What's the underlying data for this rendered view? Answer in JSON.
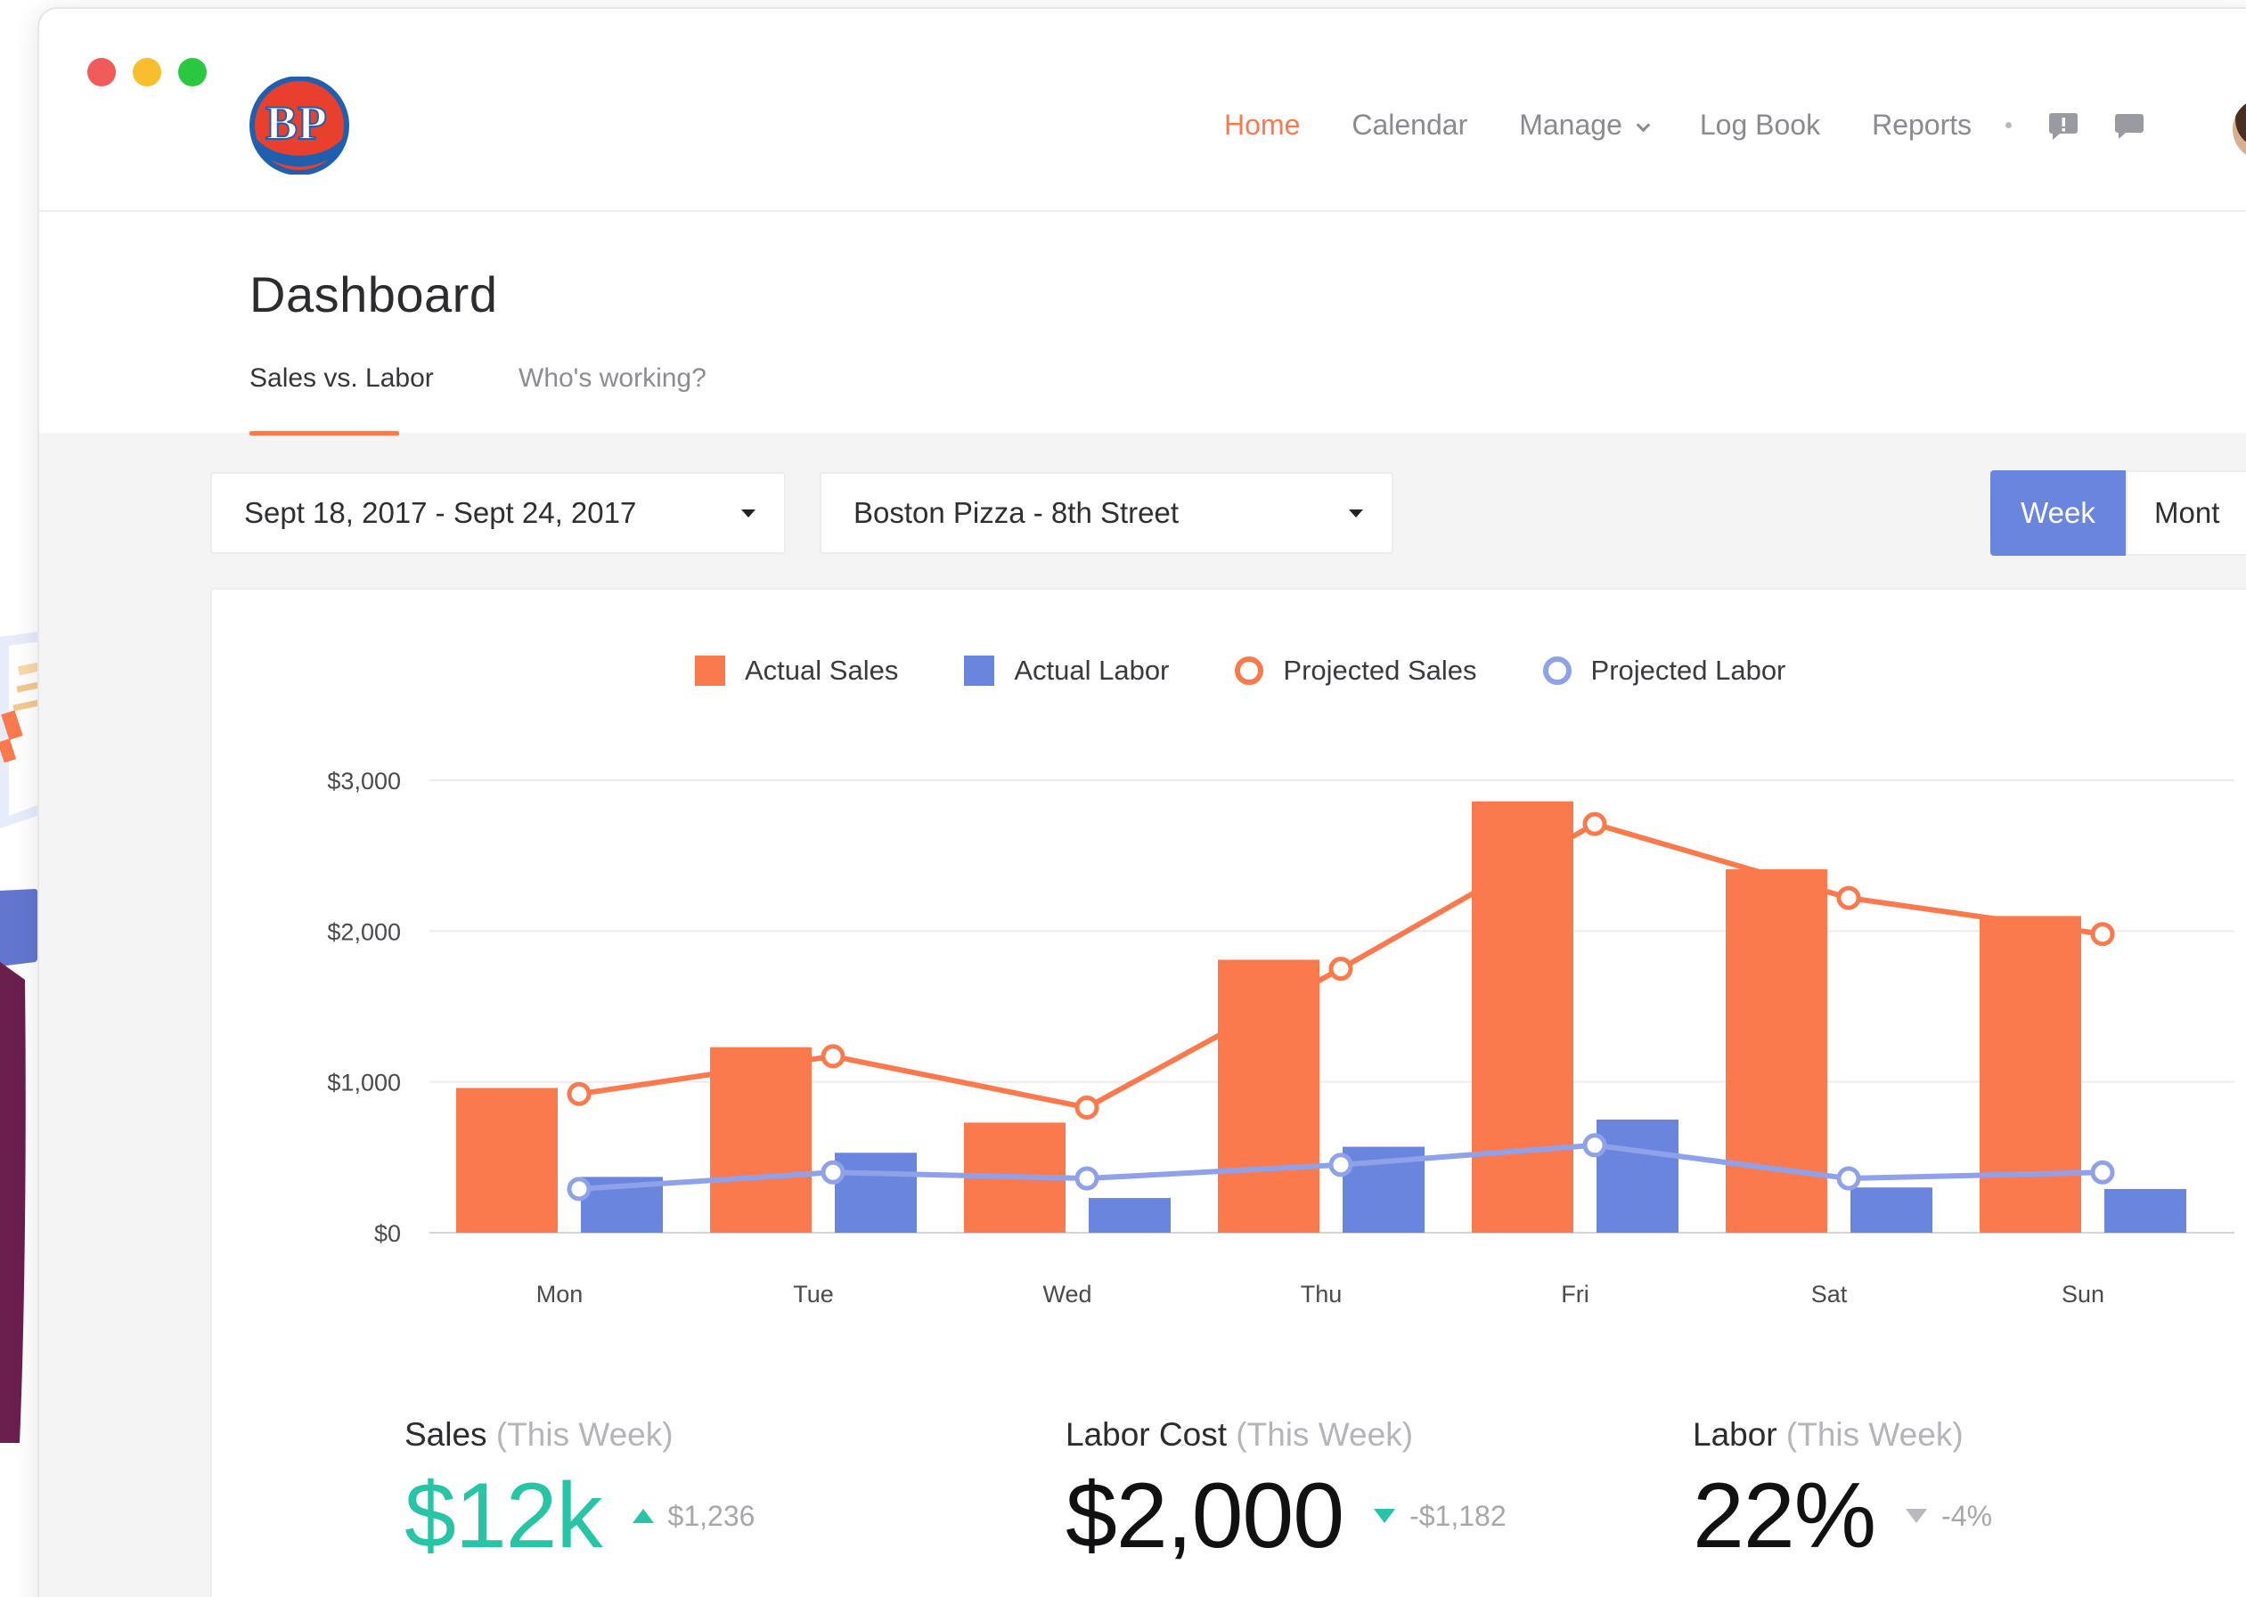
{
  "window": {
    "traffic_lights": [
      "#f15b59",
      "#f9be2e",
      "#2ac840"
    ]
  },
  "brand": {
    "logo_text": "BP",
    "logo_colors": [
      "#e8402d",
      "#1f5fb0",
      "#ffffff"
    ]
  },
  "nav": {
    "items": [
      {
        "label": "Home",
        "active": true
      },
      {
        "label": "Calendar",
        "active": false
      },
      {
        "label": "Manage",
        "active": false,
        "has_dropdown": true
      },
      {
        "label": "Log Book",
        "active": false
      },
      {
        "label": "Reports",
        "active": false
      }
    ],
    "icons": [
      "alert-icon",
      "chat-icon"
    ],
    "accent": "#fb7a4d"
  },
  "page": {
    "title": "Dashboard",
    "tabs": [
      {
        "label": "Sales vs. Labor",
        "active": true
      },
      {
        "label": "Who's working?",
        "active": false
      }
    ]
  },
  "filters": {
    "date_range": "Sept 18, 2017 - Sept 24, 2017",
    "location": "Boston Pizza - 8th Street",
    "period_options": [
      "Week",
      "Mont"
    ],
    "period_selected": "Week"
  },
  "chart_data": {
    "type": "bar",
    "categories": [
      "Mon",
      "Tue",
      "Wed",
      "Thu",
      "Fri",
      "Sat",
      "Sun"
    ],
    "ylim": [
      0,
      3000
    ],
    "y_ticks": [
      "$0",
      "$1,000",
      "$2,000",
      "$3,000"
    ],
    "y_tick_values": [
      0,
      1000,
      2000,
      3000
    ],
    "grid": true,
    "legend_position": "top-center",
    "series": [
      {
        "name": "Actual Sales",
        "kind": "bar",
        "color": "#fb7a4d",
        "values": [
          960,
          1230,
          730,
          1810,
          2860,
          2410,
          2100
        ]
      },
      {
        "name": "Actual Labor",
        "kind": "bar",
        "color": "#6a85dd",
        "values": [
          370,
          530,
          230,
          570,
          750,
          300,
          290
        ]
      },
      {
        "name": "Projected Sales",
        "kind": "line",
        "color": "#fb7a4d",
        "values": [
          920,
          1170,
          830,
          1750,
          2710,
          2220,
          1980
        ]
      },
      {
        "name": "Projected Labor",
        "kind": "line",
        "color": "#8fa1e8",
        "values": [
          290,
          400,
          360,
          450,
          580,
          360,
          400
        ]
      }
    ]
  },
  "stats": [
    {
      "label": "Sales",
      "qualifier": "(This Week)",
      "value": "$12k",
      "value_color": "#27c4a5",
      "delta": "$1,236",
      "direction": "up"
    },
    {
      "label": "Labor Cost",
      "qualifier": "(This Week)",
      "value": "$2,000",
      "value_color": "#111114",
      "delta": "-$1,182",
      "direction": "down"
    },
    {
      "label": "Labor",
      "qualifier": "(This Week)",
      "value": "22%",
      "value_color": "#111114",
      "delta": "-4%",
      "direction": "down-neutral"
    }
  ]
}
